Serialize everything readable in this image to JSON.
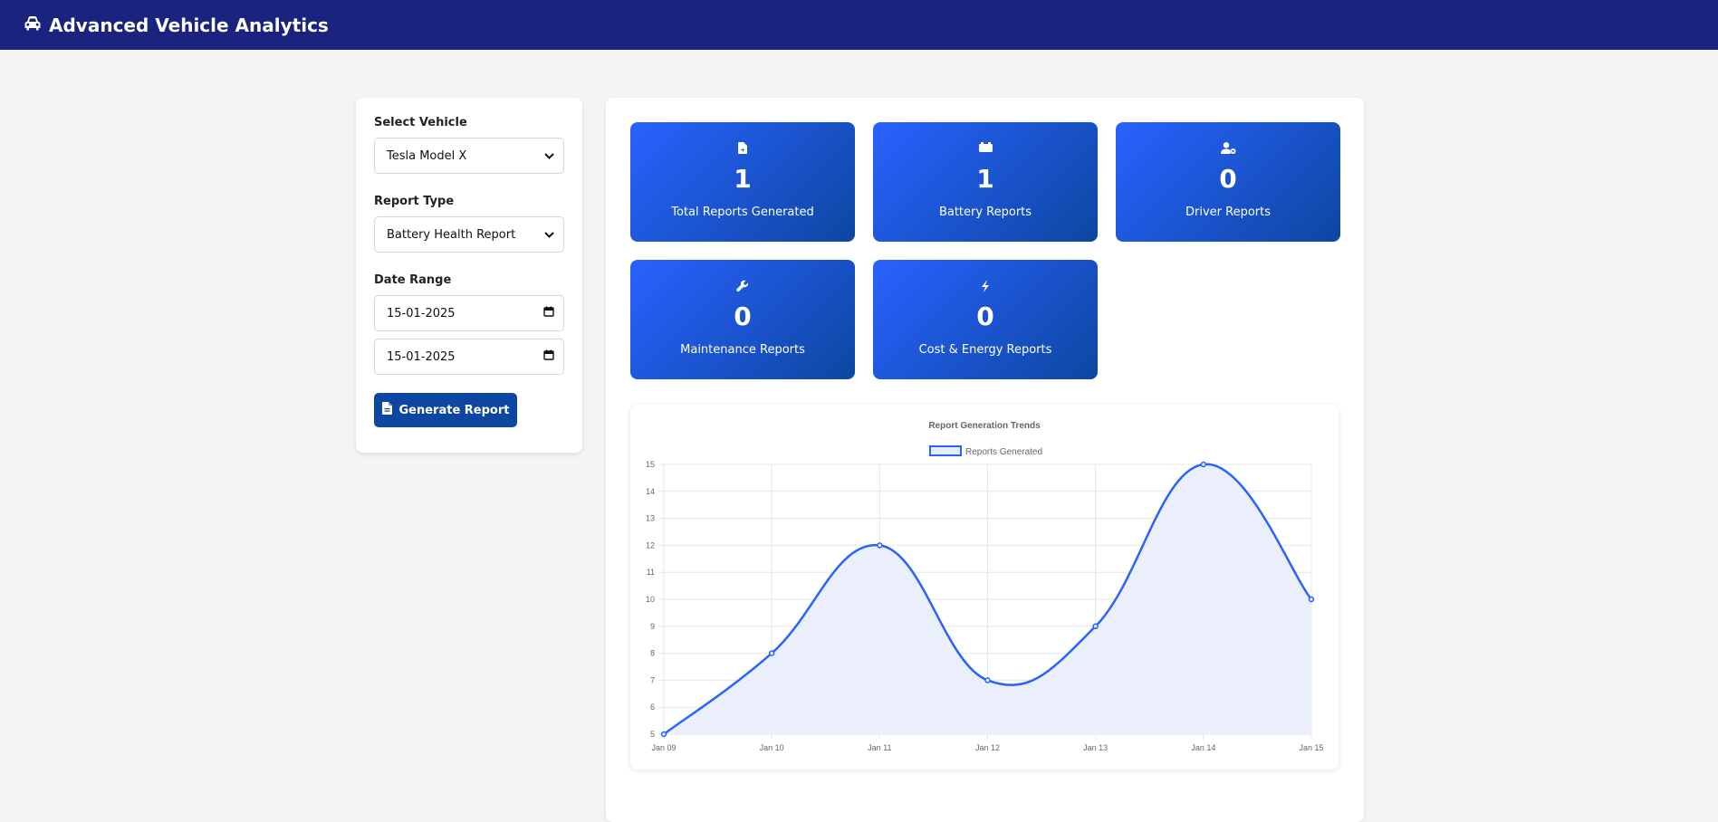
{
  "header": {
    "title": "Advanced Vehicle Analytics",
    "icon": "car-icon"
  },
  "sidebar": {
    "vehicle_label": "Select Vehicle",
    "vehicle_value": "Tesla Model X",
    "report_type_label": "Report Type",
    "report_type_value": "Battery Health Report",
    "date_range_label": "Date Range",
    "date_start": "15-01-2025",
    "date_end": "15-01-2025",
    "generate_button": "Generate Report"
  },
  "stats": [
    {
      "icon": "file-icon",
      "value": "1",
      "label": "Total Reports Generated"
    },
    {
      "icon": "battery-icon",
      "value": "1",
      "label": "Battery Reports"
    },
    {
      "icon": "user-gear-icon",
      "value": "0",
      "label": "Driver Reports"
    },
    {
      "icon": "wrench-icon",
      "value": "0",
      "label": "Maintenance Reports"
    },
    {
      "icon": "bolt-icon",
      "value": "0",
      "label": "Cost & Energy Reports"
    }
  ],
  "colors": {
    "header": "#1a237e",
    "accent": "#2962ff",
    "button": "#0d47a1"
  },
  "chart_data": {
    "type": "line",
    "title": "Report Generation Trends",
    "categories": [
      "Jan 09",
      "Jan 10",
      "Jan 11",
      "Jan 12",
      "Jan 13",
      "Jan 14",
      "Jan 15"
    ],
    "series": [
      {
        "name": "Reports Generated",
        "values": [
          5,
          8,
          12,
          7,
          9,
          15,
          10
        ]
      }
    ],
    "ylim": [
      5,
      15
    ],
    "yticks": [
      5,
      6,
      7,
      8,
      9,
      10,
      11,
      12,
      13,
      14,
      15
    ],
    "legend": "top-center",
    "grid": true,
    "fill": true,
    "line_color": "#2962ff",
    "fill_color": "#e8edfb"
  }
}
